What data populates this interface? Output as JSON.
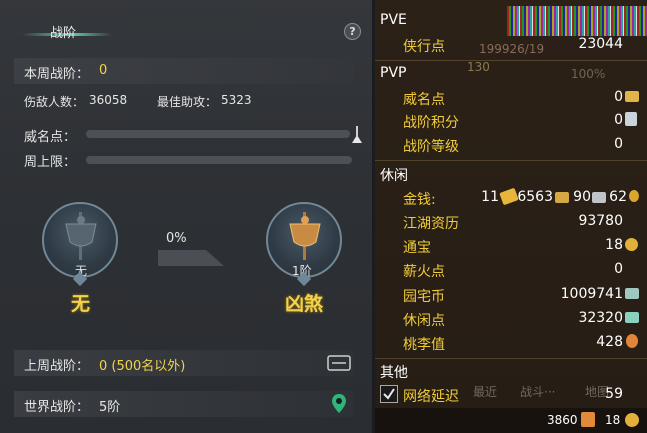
{
  "left": {
    "title": "战阶",
    "help": "?",
    "weekly_rank_label": "本周战阶：",
    "weekly_rank_value": "0",
    "injured_label": "伤敌人数：",
    "injured_value": "36058",
    "best_assist_label": "最佳助攻：",
    "best_assist_value": "5323",
    "prestige_label": "威名点：",
    "weekly_cap_label": "周上限：",
    "current_rank_small": "无",
    "current_rank_big": "无",
    "progress": "0%",
    "next_rank_small": "1阶",
    "next_rank_big": "凶煞",
    "last_week_label": "上周战阶：",
    "last_week_value": "0 (500名以外)",
    "world_rank_label": "世界战阶：",
    "world_rank_value": "5阶"
  },
  "right": {
    "pve_title": "PVE",
    "xiaxing_label": "侠行点",
    "xiaxing_value": "23044",
    "bg_numbers": "199926/19",
    "bg_130": "130",
    "bg_100": "100%",
    "pvp_title": "PVP",
    "weiming_label": "威名点",
    "weiming_value": "0",
    "zhanjie_points_label": "战阶积分",
    "zhanjie_points_value": "0",
    "zhanjie_level_label": "战阶等级",
    "zhanjie_level_value": "0",
    "leisure_title": "休闲",
    "money_label": "金钱:",
    "money_gold": "11",
    "money_silver": "6563",
    "money_copper": "90",
    "money_misc": "62",
    "jianghu_label": "江湖资历",
    "jianghu_value": "93780",
    "tongbao_label": "通宝",
    "tongbao_value": "18",
    "xinhuo_label": "薪火点",
    "xinhuo_value": "0",
    "yuanzhai_label": "园宅币",
    "yuanzhai_value": "1009741",
    "xiuxian_label": "休闲点",
    "xiuxian_value": "32320",
    "taoli_label": "桃李值",
    "taoli_value": "428",
    "other_title": "其他",
    "latency_label": "网络延迟",
    "latency_value": "59",
    "bg_tab1": "最近",
    "bg_tab2": "战斗···",
    "bg_tab3": "地图",
    "footer_left": "3860",
    "footer_right": "18"
  }
}
